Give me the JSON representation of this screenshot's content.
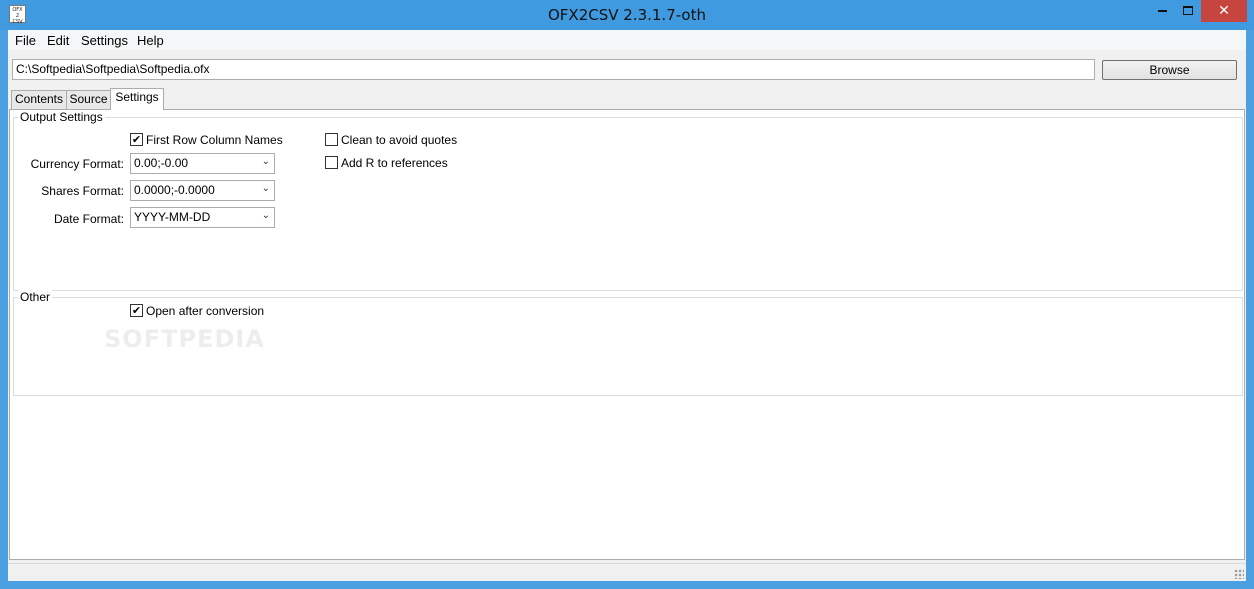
{
  "window": {
    "title": "OFX2CSV 2.3.1.7-oth",
    "icon_text_top": "OFX",
    "icon_text_mid": "2",
    "icon_text_bottom": "CSV",
    "close_glyph": "✕"
  },
  "menu": {
    "items": [
      "File",
      "Edit",
      "Settings",
      "Help"
    ]
  },
  "file_path": {
    "value": "C:\\Softpedia\\Softpedia\\Softpedia.ofx"
  },
  "browse_label": "Browse",
  "tabs": [
    "Contents",
    "Source",
    "Settings"
  ],
  "active_tab": "Settings",
  "output_settings": {
    "title": "Output Settings",
    "first_row_column_names": {
      "label": "First Row Column Names",
      "checked": true
    },
    "clean_quotes": {
      "label": "Clean to avoid quotes",
      "checked": false
    },
    "add_r_refs": {
      "label": "Add R to references",
      "checked": false
    },
    "currency_format": {
      "label": "Currency Format:",
      "value": "0.00;-0.00"
    },
    "shares_format": {
      "label": "Shares Format:",
      "value": "0.0000;-0.0000"
    },
    "date_format": {
      "label": "Date Format:",
      "value": "YYYY-MM-DD"
    }
  },
  "other": {
    "title": "Other",
    "open_after_conversion": {
      "label": "Open after conversion",
      "checked": true
    }
  },
  "check_glyph": "✔",
  "chevron_glyph": "⌄",
  "watermark_text": "SOFTPEDIA",
  "colors": {
    "titlebar": "#3f9ae0",
    "close_button": "#c7453f"
  }
}
